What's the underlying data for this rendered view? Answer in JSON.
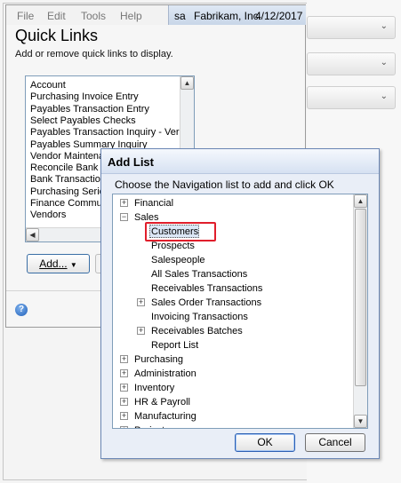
{
  "menu": {
    "file": "File",
    "edit": "Edit",
    "tools": "Tools",
    "help": "Help"
  },
  "userbar": {
    "user": "sa",
    "company": "Fabrikam, Inc.",
    "date": "4/12/2017"
  },
  "quick_links": {
    "title": "Quick Links",
    "subtitle": "Add or remove quick links to display.",
    "items": [
      "Account",
      "Purchasing Invoice Entry",
      "Payables Transaction Entry",
      "Select Payables Checks",
      "Payables Transaction Inquiry - Ver",
      "Payables Summary Inquiry",
      "Vendor Maintena",
      "Reconcile Bank S",
      "Bank Transaction",
      "Purchasing Series",
      "Finance Commun",
      "Vendors"
    ],
    "add_button": "Add...",
    "add_arrow": "▼"
  },
  "add_list": {
    "title": "Add List",
    "prompt": "Choose the Navigation list to add and click OK",
    "tree": [
      {
        "label": "Financial",
        "level": 0,
        "expander": "+"
      },
      {
        "label": "Sales",
        "level": 0,
        "expander": "−"
      },
      {
        "label": "Customers",
        "level": 1,
        "expander": "",
        "selected": true
      },
      {
        "label": "Prospects",
        "level": 1,
        "expander": ""
      },
      {
        "label": "Salespeople",
        "level": 1,
        "expander": ""
      },
      {
        "label": "All Sales Transactions",
        "level": 1,
        "expander": ""
      },
      {
        "label": "Receivables Transactions",
        "level": 1,
        "expander": ""
      },
      {
        "label": "Sales Order Transactions",
        "level": 1,
        "expander": "+"
      },
      {
        "label": "Invoicing Transactions",
        "level": 1,
        "expander": ""
      },
      {
        "label": "Receivables Batches",
        "level": 1,
        "expander": "+"
      },
      {
        "label": "Report List",
        "level": 1,
        "expander": ""
      },
      {
        "label": "Purchasing",
        "level": 0,
        "expander": "+"
      },
      {
        "label": "Administration",
        "level": 0,
        "expander": "+"
      },
      {
        "label": "Inventory",
        "level": 0,
        "expander": "+"
      },
      {
        "label": "HR & Payroll",
        "level": 0,
        "expander": "+"
      },
      {
        "label": "Manufacturing",
        "level": 0,
        "expander": "+"
      },
      {
        "label": "Project",
        "level": 0,
        "expander": "+"
      }
    ],
    "ok_button": "OK",
    "cancel_button": "Cancel"
  },
  "colors": {
    "highlight_box": "#e01e2b",
    "selection_bg": "#dbe6f5",
    "title_bar": "#d6e1f2"
  }
}
